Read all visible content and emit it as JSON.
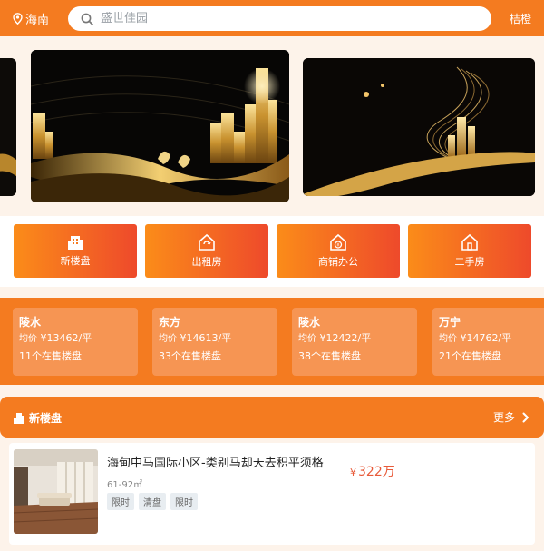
{
  "header": {
    "location": "海南",
    "search_placeholder": "盛世佳园",
    "brand": "桔橙"
  },
  "categories": [
    {
      "label": "新楼盘",
      "icon": "building-icon"
    },
    {
      "label": "出租房",
      "icon": "house-refresh-icon"
    },
    {
      "label": "商铺办公",
      "icon": "house-yen-icon"
    },
    {
      "label": "二手房",
      "icon": "house-icon"
    }
  ],
  "areas": [
    {
      "name": "陵水",
      "avg_label": "均价",
      "price": "¥13462/平",
      "count": "11个在售楼盘"
    },
    {
      "name": "东方",
      "avg_label": "均价",
      "price": "¥14613/平",
      "count": "33个在售楼盘"
    },
    {
      "name": "陵水",
      "avg_label": "均价",
      "price": "¥12422/平",
      "count": "38个在售楼盘"
    },
    {
      "name": "万宁",
      "avg_label": "均价",
      "price": "¥14762/平",
      "count": "21个在售楼盘"
    }
  ],
  "section": {
    "title": "新楼盘",
    "more": "更多"
  },
  "listing": {
    "title": "海甸中马国际小区-类别马却天去积平须格",
    "price_symbol": "¥",
    "price": "322万",
    "area": "61-92㎡",
    "tags": [
      "限时",
      "清盘",
      "限时"
    ]
  },
  "colors": {
    "primary": "#f47b20",
    "gradient_start": "#fb8c19",
    "gradient_end": "#ee4a2b",
    "price": "#e85b3a",
    "background": "#fdf3ea"
  }
}
